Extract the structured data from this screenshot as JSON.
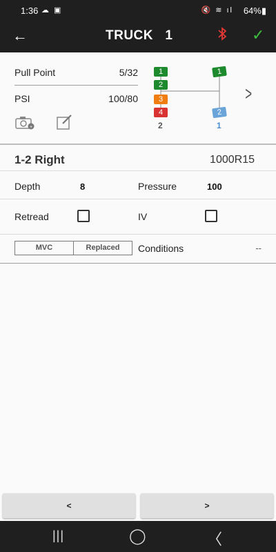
{
  "status_bar": {
    "time": "1:36",
    "left_icons": "☁ ▣",
    "right_icons": "🔇 ≋ ıl",
    "battery": "64%▮"
  },
  "app_bar": {
    "back_icon": "arrow-left-icon",
    "title": "TRUCK   1",
    "bluetooth_icon": "bluetooth-icon",
    "confirm_icon": "check-icon",
    "bluetooth_color": "#e53935",
    "confirm_color": "#3fbf3f"
  },
  "summary": {
    "pull_point_label": "Pull Point",
    "pull_point_value": "5/32",
    "psi_label": "PSI",
    "psi_value": "100/80"
  },
  "diagram": {
    "axle_2": {
      "tires": [
        "1",
        "2",
        "3",
        "4"
      ],
      "colors": [
        "green",
        "green",
        "orange",
        "red"
      ],
      "label": "2"
    },
    "axle_1": {
      "tires": [
        "1",
        "2"
      ],
      "colors": [
        "green",
        "blue"
      ],
      "label": "1"
    }
  },
  "tire_detail": {
    "name": "1-2 Right",
    "size": "1000R15",
    "depth_label": "Depth",
    "depth_value": "8",
    "pressure_label": "Pressure",
    "pressure_value": "100",
    "retread_label": "Retread",
    "iv_label": "IV",
    "mvc_label": "MVC",
    "replaced_label": "Replaced",
    "conditions_label": "Conditions",
    "conditions_value": "--"
  },
  "nav": {
    "prev_label": "<",
    "next_label": ">"
  },
  "system_nav": {
    "recents": "|||",
    "home": "◯",
    "back": "〈"
  }
}
